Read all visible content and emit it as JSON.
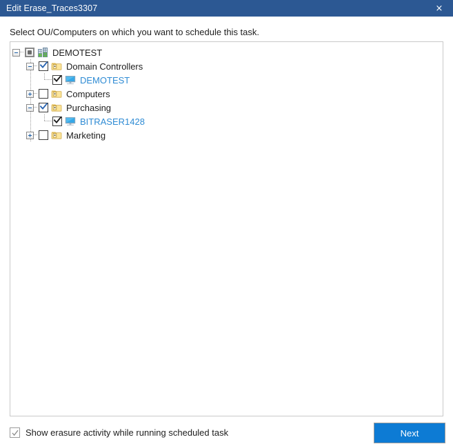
{
  "window": {
    "title": "Edit Erase_Traces3307",
    "close_label": "×",
    "titlebar_color": "#2c5893"
  },
  "instruction": "Select OU/Computers on which you want to schedule this task.",
  "tree": {
    "nodes": [
      {
        "label": "DEMOTEST",
        "level": 0,
        "expander": "minus",
        "check": "partial",
        "icon": "organization-icon",
        "label_color": "default"
      },
      {
        "label": "Domain Controllers",
        "level": 1,
        "expander": "minus",
        "check": "checked-blue",
        "icon": "ou-folder-icon",
        "label_color": "default"
      },
      {
        "label": "DEMOTEST",
        "level": 2,
        "expander": "elbow",
        "check": "checked-dark",
        "icon": "computer-icon",
        "label_color": "blue"
      },
      {
        "label": "Computers",
        "level": 1,
        "expander": "plus",
        "check": "unchecked",
        "icon": "ou-folder-icon",
        "label_color": "default"
      },
      {
        "label": "Purchasing",
        "level": 1,
        "expander": "minus",
        "check": "checked-blue",
        "icon": "ou-folder-icon",
        "label_color": "default"
      },
      {
        "label": "BITRASER1428",
        "level": 2,
        "expander": "elbow",
        "check": "checked-dark",
        "icon": "computer-icon",
        "label_color": "blue"
      },
      {
        "label": "Marketing",
        "level": 1,
        "expander": "plus",
        "check": "unchecked",
        "icon": "ou-folder-icon",
        "label_color": "default"
      }
    ]
  },
  "footer": {
    "show_activity_label": "Show erasure activity while running scheduled task",
    "show_activity_checked": true,
    "next_label": "Next",
    "next_color": "#0d7bd4"
  }
}
